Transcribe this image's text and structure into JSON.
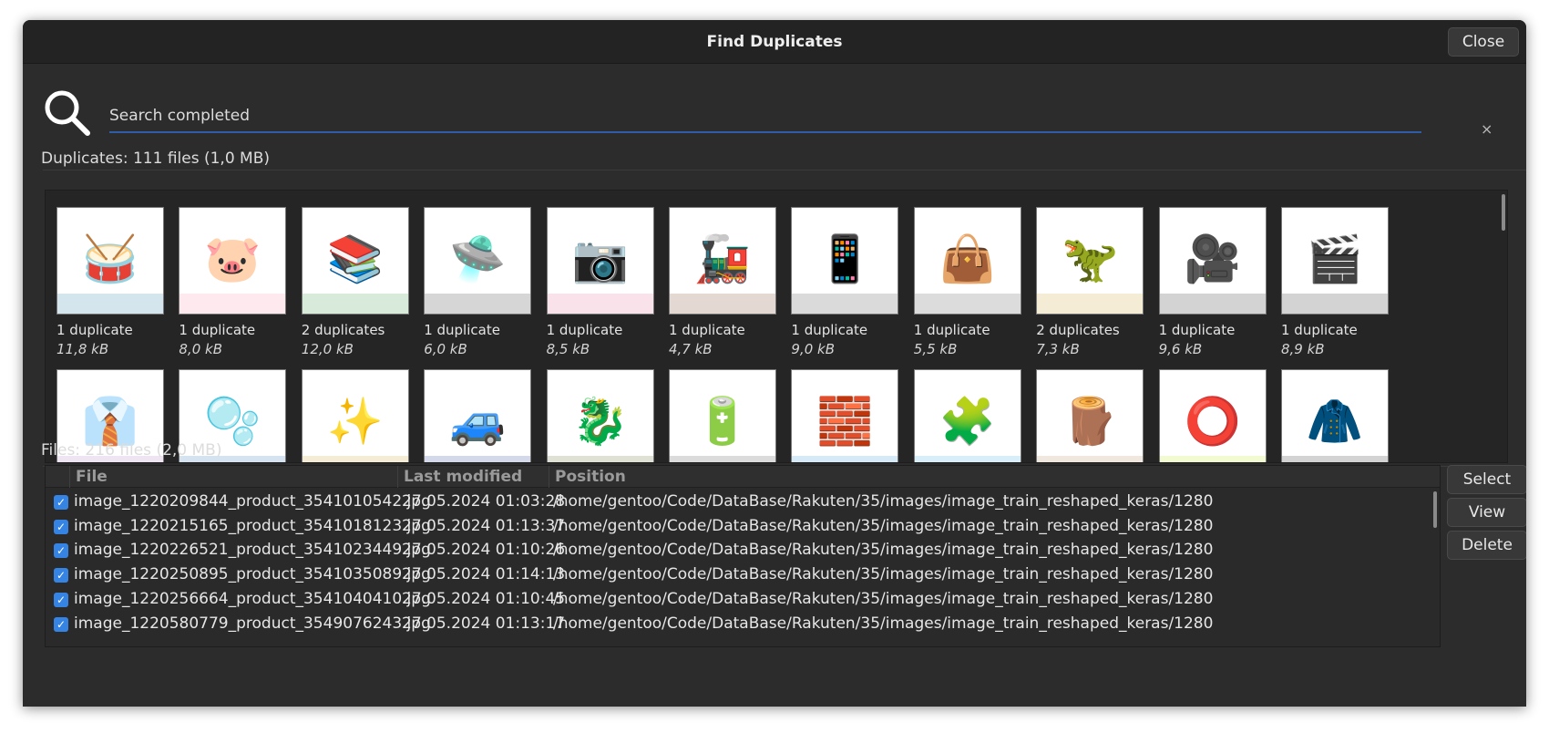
{
  "window": {
    "title": "Find Duplicates",
    "close_label": "Close"
  },
  "search": {
    "status_text": "Search completed",
    "clear_icon": "×"
  },
  "duplicates": {
    "summary": "Duplicates: 111 files (1,0 MB)",
    "items": [
      {
        "count": "1 duplicate",
        "size": "11,8 kB",
        "icon": "🥁",
        "tint": "#2f7fa8"
      },
      {
        "count": "1 duplicate",
        "size": "8,0 kB",
        "icon": "🐷",
        "tint": "#f590a8"
      },
      {
        "count": "2 duplicates",
        "size": "12,0 kB",
        "icon": "📚",
        "tint": "#3c9a4d"
      },
      {
        "count": "1 duplicate",
        "size": "6,0 kB",
        "icon": "🛸",
        "tint": "#333333"
      },
      {
        "count": "1 duplicate",
        "size": "8,5 kB",
        "icon": "📷",
        "tint": "#e86f9a"
      },
      {
        "count": "1 duplicate",
        "size": "4,7 kB",
        "icon": "🚂",
        "tint": "#7a3a20"
      },
      {
        "count": "1 duplicate",
        "size": "9,0 kB",
        "icon": "📱",
        "tint": "#444444"
      },
      {
        "count": "1 duplicate",
        "size": "5,5 kB",
        "icon": "👜",
        "tint": "#505050"
      },
      {
        "count": "2 duplicates",
        "size": "7,3 kB",
        "icon": "🦖",
        "tint": "#c9a028"
      },
      {
        "count": "1 duplicate",
        "size": "9,6 kB",
        "icon": "🎥",
        "tint": "#222222"
      },
      {
        "count": "1 duplicate",
        "size": "8,9 kB",
        "icon": "🎬",
        "tint": "#222222"
      },
      {
        "count": "",
        "size": "",
        "icon": "👔",
        "tint": "#b07cc0"
      },
      {
        "count": "",
        "size": "",
        "icon": "🫧",
        "tint": "#2e6fb0"
      },
      {
        "count": "",
        "size": "",
        "icon": "✨",
        "tint": "#c9a028"
      },
      {
        "count": "",
        "size": "",
        "icon": "🚙",
        "tint": "#2a3f8f"
      },
      {
        "count": "",
        "size": "",
        "icon": "🐉",
        "tint": "#5b6b2a"
      },
      {
        "count": "",
        "size": "",
        "icon": "🔋",
        "tint": "#4a4a4a"
      },
      {
        "count": "",
        "size": "",
        "icon": "🧱",
        "tint": "#2d8fd8"
      },
      {
        "count": "",
        "size": "",
        "icon": "🧩",
        "tint": "#3bb0e0"
      },
      {
        "count": "",
        "size": "",
        "icon": "🪵",
        "tint": "#b58b5a"
      },
      {
        "count": "",
        "size": "",
        "icon": "⭕",
        "tint": "#b7e81a"
      },
      {
        "count": "",
        "size": "",
        "icon": "🧥",
        "tint": "#222222"
      }
    ]
  },
  "files": {
    "summary": "Files: 216 files (2,0 MB)",
    "columns": {
      "file": "File",
      "modified": "Last modified",
      "position": "Position"
    },
    "rows": [
      {
        "checked": true,
        "file": "image_1220209844_product_3541010542.jpg",
        "modified": "27.05.2024 01:03:28",
        "position": "/home/gentoo/Code/DataBase/Rakuten/35/images/image_train_reshaped_keras/1280"
      },
      {
        "checked": true,
        "file": "image_1220215165_product_3541018123.jpg",
        "modified": "27.05.2024 01:13:37",
        "position": "/home/gentoo/Code/DataBase/Rakuten/35/images/image_train_reshaped_keras/1280"
      },
      {
        "checked": true,
        "file": "image_1220226521_product_3541023449.jpg",
        "modified": "27.05.2024 01:10:26",
        "position": "/home/gentoo/Code/DataBase/Rakuten/35/images/image_train_reshaped_keras/1280"
      },
      {
        "checked": true,
        "file": "image_1220250895_product_3541035089.jpg",
        "modified": "27.05.2024 01:14:13",
        "position": "/home/gentoo/Code/DataBase/Rakuten/35/images/image_train_reshaped_keras/1280"
      },
      {
        "checked": true,
        "file": "image_1220256664_product_3541040410.jpg",
        "modified": "27.05.2024 01:10:45",
        "position": "/home/gentoo/Code/DataBase/Rakuten/35/images/image_train_reshaped_keras/1280"
      },
      {
        "checked": true,
        "file": "image_1220580779_product_3549076243.jpg",
        "modified": "27.05.2024 01:13:17",
        "position": "/home/gentoo/Code/DataBase/Rakuten/35/images/image_train_reshaped_keras/1280"
      }
    ]
  },
  "actions": {
    "select": "Select",
    "view": "View",
    "delete": "Delete"
  }
}
